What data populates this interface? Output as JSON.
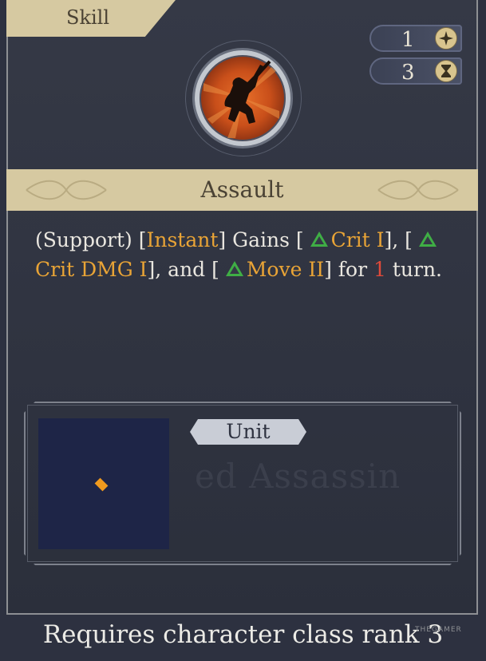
{
  "header": {
    "tab_label": "Skill"
  },
  "costs": [
    {
      "value": "1",
      "icon": "sparkle-icon"
    },
    {
      "value": "3",
      "icon": "hourglass-icon"
    }
  ],
  "skill": {
    "name": "Assault",
    "description": {
      "p1": "(Support) [",
      "instant": "Instant",
      "p2": "] Gains [ ",
      "buff1": "Crit I",
      "p3": "], [ ",
      "buff2": "Crit DMG I",
      "p4": "], and [ ",
      "buff3": "Move II",
      "p5": "] for ",
      "turns": "1",
      "p6": " turn."
    }
  },
  "range_panel": {
    "label": "Unit",
    "ghost_text": "ed Assassin"
  },
  "footer": {
    "requirement": "Requires character class rank 3",
    "watermark": "THEGAMER"
  },
  "colors": {
    "accent_gold": "#e9a436",
    "buff_green": "#3fae45",
    "turn_red": "#e04a3a",
    "banner": "#d6c9a1"
  }
}
